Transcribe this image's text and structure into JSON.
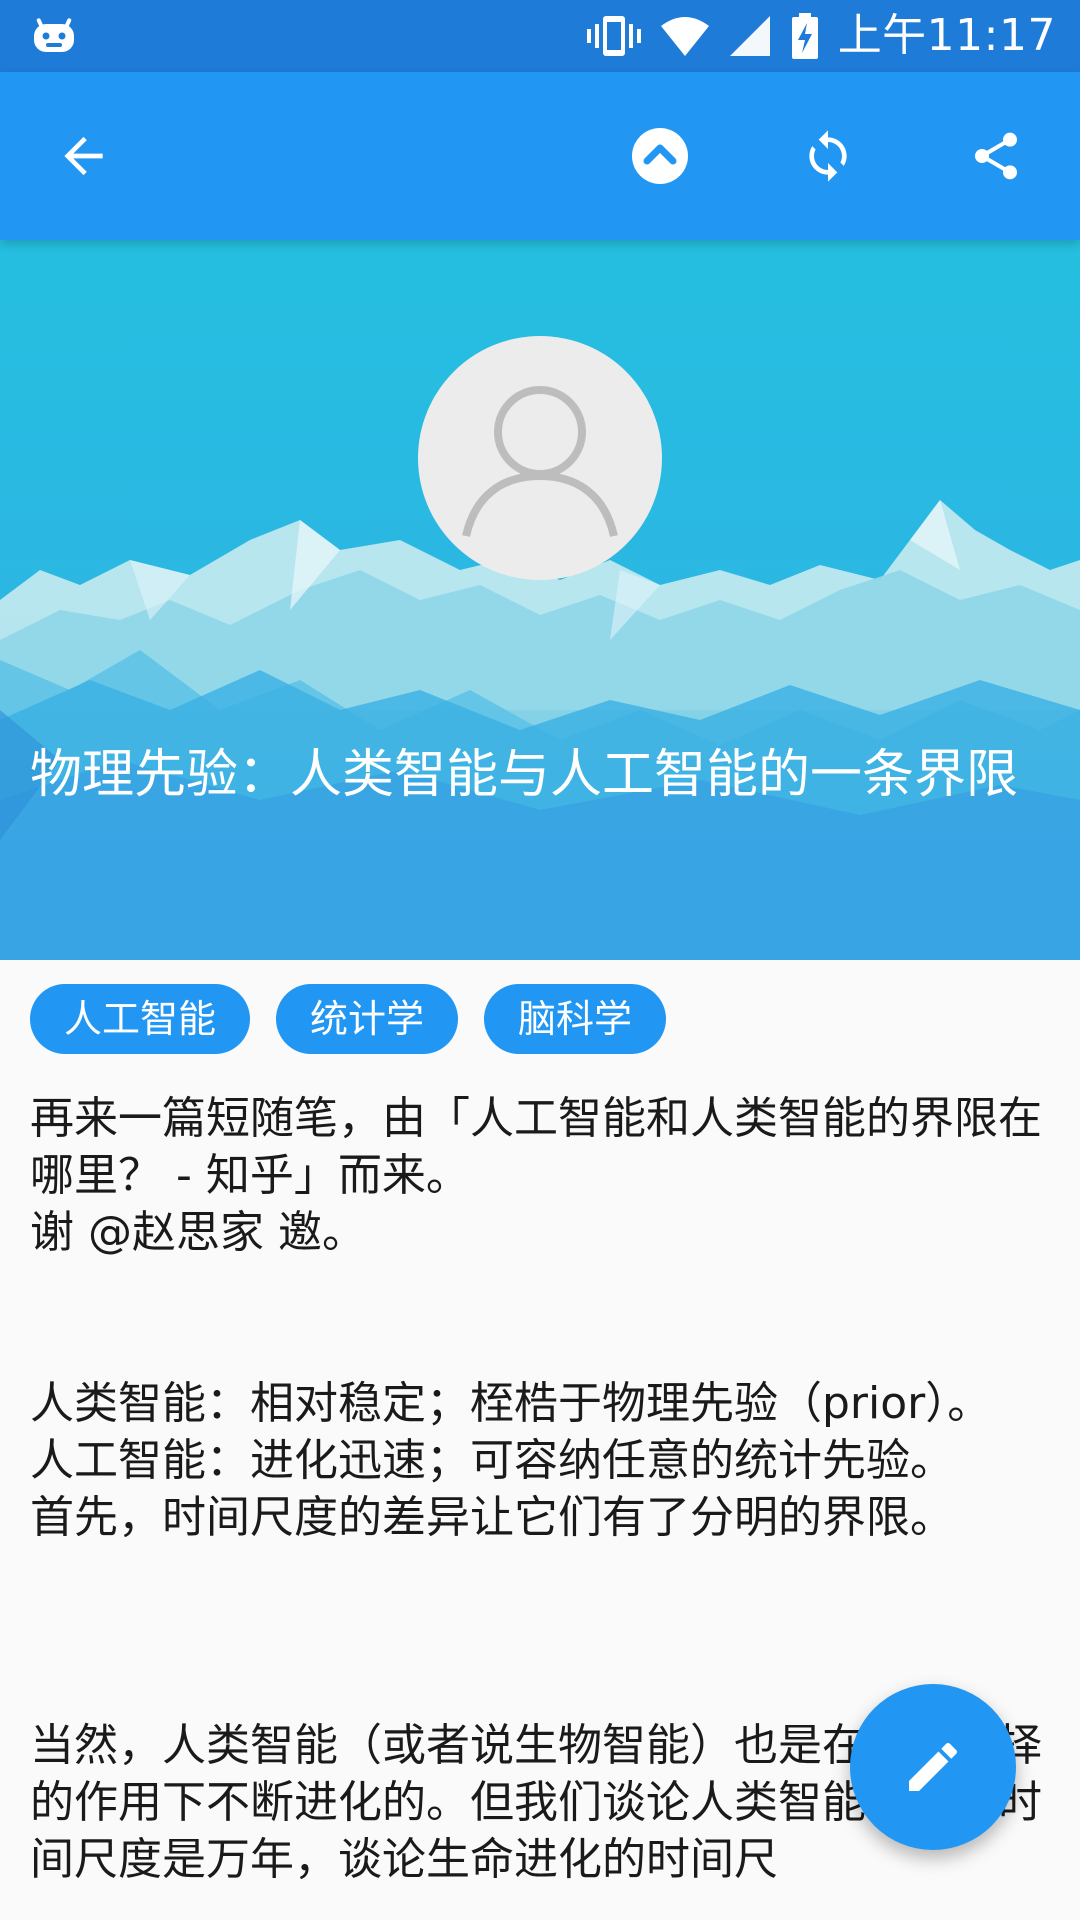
{
  "status_bar": {
    "time": "上午11:17",
    "icons": [
      "android-debug-icon",
      "vibrate-icon",
      "wifi-icon",
      "signal-icon",
      "battery-charging-icon"
    ]
  },
  "app_bar": {
    "back_icon": "arrow-back-icon",
    "scroll_top_icon": "chevron-up-icon",
    "refresh_icon": "refresh-icon",
    "share_icon": "share-icon",
    "color": "#2196f3"
  },
  "hero": {
    "title": "物理先验：人类智能与人工智能的一条界限",
    "avatar_icon": "person-placeholder-icon"
  },
  "tags": [
    {
      "label": "人工智能"
    },
    {
      "label": "统计学"
    },
    {
      "label": "脑科学"
    }
  ],
  "content": {
    "paragraph1": "再来一篇短随笔，由「人工智能和人类智能的界限在哪里？ - 知乎」而来。\n谢 @赵思家 邀。",
    "paragraph2": "人类智能：相对稳定；桎梏于物理先验（prior）。\n人工智能：进化迅速；可容纳任意的统计先验。\n首先，时间尺度的差异让它们有了分明的界限。",
    "paragraph3": "当然，人类智能（或者说生物智能）也是在自然选择的作用下不断进化的。但我们谈论人类智能进化的时间尺度是万年，谈论生命进化的时间尺"
  },
  "fab": {
    "icon": "edit-pencil-icon"
  }
}
